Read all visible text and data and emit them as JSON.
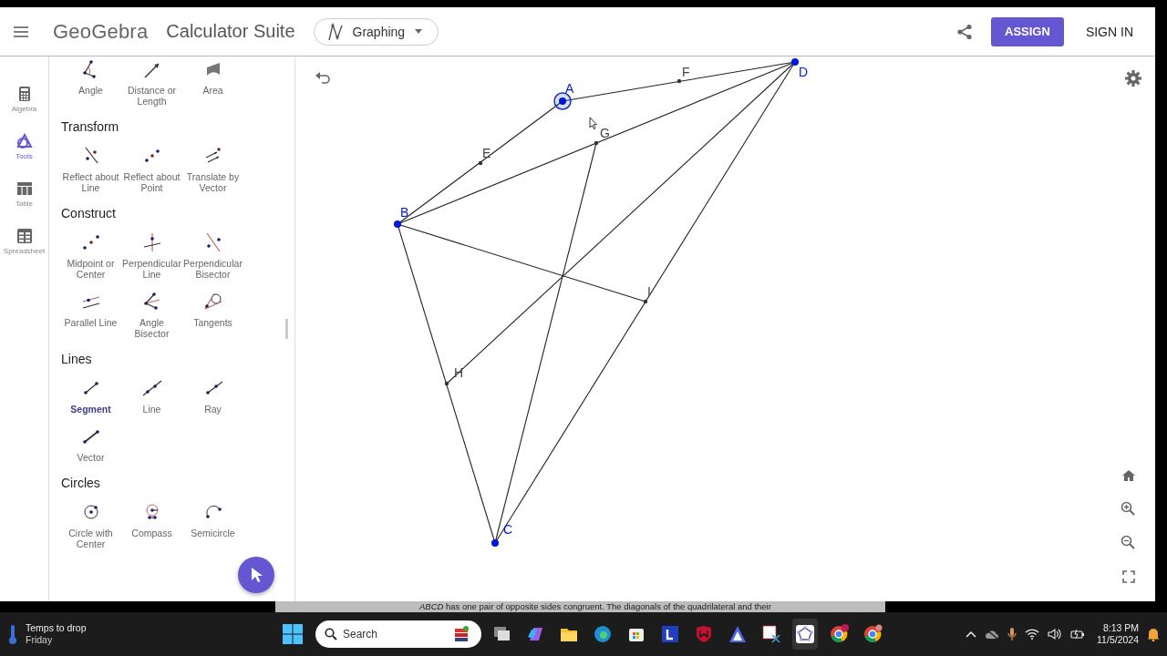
{
  "header": {
    "app_name": "GeoGebra",
    "title": "Calculator Suite",
    "app_switcher": "Graphing",
    "assign_button": "ASSIGN",
    "sign_in": "SIGN IN"
  },
  "rail": [
    {
      "label": "Algebra",
      "selected": false
    },
    {
      "label": "Tools",
      "selected": true
    },
    {
      "label": "Table",
      "selected": false
    },
    {
      "label": "Spreadsheet",
      "selected": false
    }
  ],
  "tool_sections": [
    {
      "tools": [
        {
          "label": "Angle",
          "selected": false
        },
        {
          "label": "Distance or Length",
          "selected": false
        },
        {
          "label": "Area",
          "selected": false
        }
      ]
    },
    {
      "title": "Transform",
      "tools": [
        {
          "label": "Reflect about Line",
          "selected": false
        },
        {
          "label": "Reflect about Point",
          "selected": false
        },
        {
          "label": "Translate by Vector",
          "selected": false
        }
      ]
    },
    {
      "title": "Construct",
      "tools": [
        {
          "label": "Midpoint or Center",
          "selected": false
        },
        {
          "label": "Perpendicular Line",
          "selected": false
        },
        {
          "label": "Perpendicular Bisector",
          "selected": false
        },
        {
          "label": "Parallel Line",
          "selected": false
        },
        {
          "label": "Angle Bisector",
          "selected": false
        },
        {
          "label": "Tangents",
          "selected": false
        }
      ]
    },
    {
      "title": "Lines",
      "tools": [
        {
          "label": "Segment",
          "selected": true
        },
        {
          "label": "Line",
          "selected": false
        },
        {
          "label": "Ray",
          "selected": false
        },
        {
          "label": "Vector",
          "selected": false
        }
      ]
    },
    {
      "title": "Circles",
      "tools": [
        {
          "label": "Circle with Center",
          "selected": false
        },
        {
          "label": "Compass",
          "selected": false
        },
        {
          "label": "Semicircle",
          "selected": false
        }
      ]
    }
  ],
  "canvas": {
    "points": [
      {
        "label": "A",
        "kind": "free",
        "selected": true
      },
      {
        "label": "F",
        "kind": "dependent",
        "selected": false
      },
      {
        "label": "D",
        "kind": "free",
        "selected": false
      },
      {
        "label": "G",
        "kind": "dependent",
        "selected": false
      },
      {
        "label": "E",
        "kind": "dependent",
        "selected": false
      },
      {
        "label": "B",
        "kind": "free",
        "selected": false
      },
      {
        "label": "I",
        "kind": "dependent",
        "selected": false
      },
      {
        "label": "H",
        "kind": "dependent",
        "selected": false
      },
      {
        "label": "C",
        "kind": "free",
        "selected": false
      }
    ]
  },
  "hint_strip": "*ABCD* has one pair of opposite sides congruent. The diagonals of the quadrilateral and their",
  "taskbar": {
    "weather_title": "Temps to drop",
    "weather_subtitle": "Friday",
    "search_placeholder": "Search",
    "time": "8:13 PM",
    "date": "11/5/2024"
  }
}
